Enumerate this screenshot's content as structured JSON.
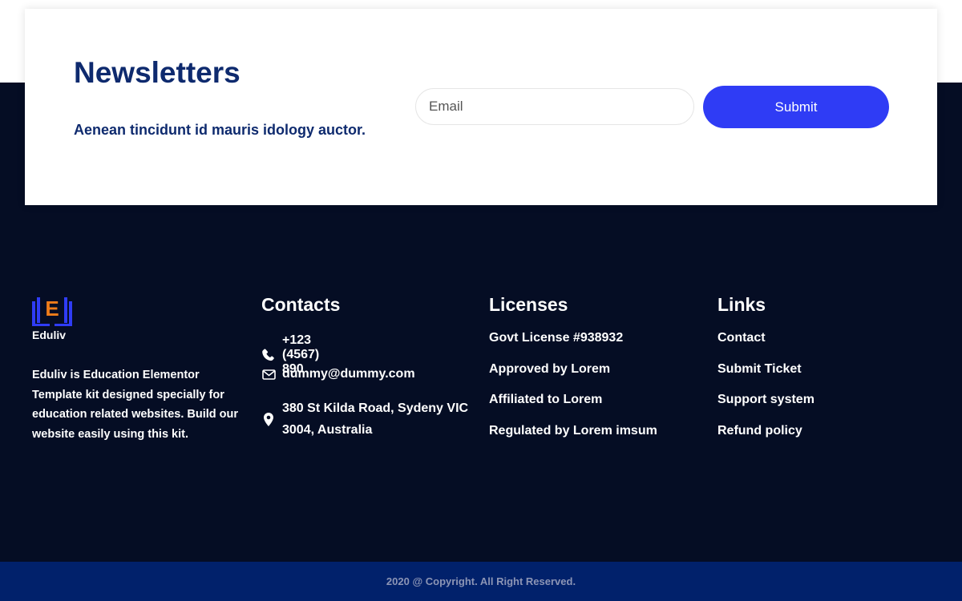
{
  "newsletter": {
    "title": "Newsletters",
    "subtitle": "Aenean tincidunt id mauris idology auctor.",
    "email_placeholder": "Email",
    "submit_label": "Submit"
  },
  "brand": {
    "logo_letter": "E",
    "name": "Eduliv",
    "description": "Eduliv is Education Elementor Template kit designed specially for education related websites. Build our website easily using this kit."
  },
  "contacts": {
    "title": "Contacts",
    "phone": "+123 (4567) 890",
    "email": "dummy@dummy.com",
    "address": "380 St Kilda Road, Sydeny VIC 3004, Australia",
    "icons": [
      "phone-icon",
      "envelope-icon",
      "map-pin-icon"
    ]
  },
  "licenses": {
    "title": "Licenses",
    "items": [
      "Govt License #938932",
      "Approved by Lorem",
      "Affiliated to Lorem",
      "Regulated by Lorem imsum"
    ]
  },
  "links": {
    "title": "Links",
    "items": [
      "Contact",
      "Submit Ticket",
      "Support system",
      "Refund policy"
    ]
  },
  "footer": {
    "copyright": "2020 @ Copyright. All Right Reserved."
  },
  "colors": {
    "navy_heading": "#0e2a6e",
    "dark_background": "#050d24",
    "accent_button": "#2f3cf5",
    "footer_bar": "#01216b",
    "logo_orange": "#f07d1a",
    "logo_blue": "#2f3cf5"
  }
}
